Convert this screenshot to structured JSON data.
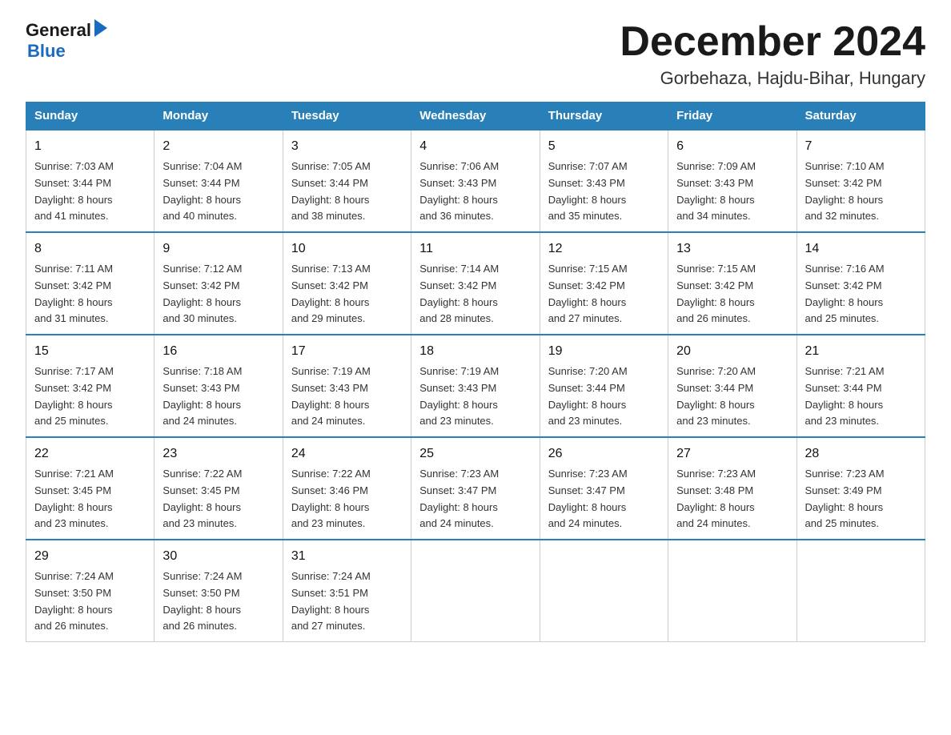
{
  "logo": {
    "general": "General",
    "blue": "Blue"
  },
  "header": {
    "month": "December 2024",
    "location": "Gorbehaza, Hajdu-Bihar, Hungary"
  },
  "days_of_week": [
    "Sunday",
    "Monday",
    "Tuesday",
    "Wednesday",
    "Thursday",
    "Friday",
    "Saturday"
  ],
  "weeks": [
    [
      {
        "day": "1",
        "sunrise": "7:03 AM",
        "sunset": "3:44 PM",
        "daylight": "8 hours and 41 minutes."
      },
      {
        "day": "2",
        "sunrise": "7:04 AM",
        "sunset": "3:44 PM",
        "daylight": "8 hours and 40 minutes."
      },
      {
        "day": "3",
        "sunrise": "7:05 AM",
        "sunset": "3:44 PM",
        "daylight": "8 hours and 38 minutes."
      },
      {
        "day": "4",
        "sunrise": "7:06 AM",
        "sunset": "3:43 PM",
        "daylight": "8 hours and 36 minutes."
      },
      {
        "day": "5",
        "sunrise": "7:07 AM",
        "sunset": "3:43 PM",
        "daylight": "8 hours and 35 minutes."
      },
      {
        "day": "6",
        "sunrise": "7:09 AM",
        "sunset": "3:43 PM",
        "daylight": "8 hours and 34 minutes."
      },
      {
        "day": "7",
        "sunrise": "7:10 AM",
        "sunset": "3:42 PM",
        "daylight": "8 hours and 32 minutes."
      }
    ],
    [
      {
        "day": "8",
        "sunrise": "7:11 AM",
        "sunset": "3:42 PM",
        "daylight": "8 hours and 31 minutes."
      },
      {
        "day": "9",
        "sunrise": "7:12 AM",
        "sunset": "3:42 PM",
        "daylight": "8 hours and 30 minutes."
      },
      {
        "day": "10",
        "sunrise": "7:13 AM",
        "sunset": "3:42 PM",
        "daylight": "8 hours and 29 minutes."
      },
      {
        "day": "11",
        "sunrise": "7:14 AM",
        "sunset": "3:42 PM",
        "daylight": "8 hours and 28 minutes."
      },
      {
        "day": "12",
        "sunrise": "7:15 AM",
        "sunset": "3:42 PM",
        "daylight": "8 hours and 27 minutes."
      },
      {
        "day": "13",
        "sunrise": "7:15 AM",
        "sunset": "3:42 PM",
        "daylight": "8 hours and 26 minutes."
      },
      {
        "day": "14",
        "sunrise": "7:16 AM",
        "sunset": "3:42 PM",
        "daylight": "8 hours and 25 minutes."
      }
    ],
    [
      {
        "day": "15",
        "sunrise": "7:17 AM",
        "sunset": "3:42 PM",
        "daylight": "8 hours and 25 minutes."
      },
      {
        "day": "16",
        "sunrise": "7:18 AM",
        "sunset": "3:43 PM",
        "daylight": "8 hours and 24 minutes."
      },
      {
        "day": "17",
        "sunrise": "7:19 AM",
        "sunset": "3:43 PM",
        "daylight": "8 hours and 24 minutes."
      },
      {
        "day": "18",
        "sunrise": "7:19 AM",
        "sunset": "3:43 PM",
        "daylight": "8 hours and 23 minutes."
      },
      {
        "day": "19",
        "sunrise": "7:20 AM",
        "sunset": "3:44 PM",
        "daylight": "8 hours and 23 minutes."
      },
      {
        "day": "20",
        "sunrise": "7:20 AM",
        "sunset": "3:44 PM",
        "daylight": "8 hours and 23 minutes."
      },
      {
        "day": "21",
        "sunrise": "7:21 AM",
        "sunset": "3:44 PM",
        "daylight": "8 hours and 23 minutes."
      }
    ],
    [
      {
        "day": "22",
        "sunrise": "7:21 AM",
        "sunset": "3:45 PM",
        "daylight": "8 hours and 23 minutes."
      },
      {
        "day": "23",
        "sunrise": "7:22 AM",
        "sunset": "3:45 PM",
        "daylight": "8 hours and 23 minutes."
      },
      {
        "day": "24",
        "sunrise": "7:22 AM",
        "sunset": "3:46 PM",
        "daylight": "8 hours and 23 minutes."
      },
      {
        "day": "25",
        "sunrise": "7:23 AM",
        "sunset": "3:47 PM",
        "daylight": "8 hours and 24 minutes."
      },
      {
        "day": "26",
        "sunrise": "7:23 AM",
        "sunset": "3:47 PM",
        "daylight": "8 hours and 24 minutes."
      },
      {
        "day": "27",
        "sunrise": "7:23 AM",
        "sunset": "3:48 PM",
        "daylight": "8 hours and 24 minutes."
      },
      {
        "day": "28",
        "sunrise": "7:23 AM",
        "sunset": "3:49 PM",
        "daylight": "8 hours and 25 minutes."
      }
    ],
    [
      {
        "day": "29",
        "sunrise": "7:24 AM",
        "sunset": "3:50 PM",
        "daylight": "8 hours and 26 minutes."
      },
      {
        "day": "30",
        "sunrise": "7:24 AM",
        "sunset": "3:50 PM",
        "daylight": "8 hours and 26 minutes."
      },
      {
        "day": "31",
        "sunrise": "7:24 AM",
        "sunset": "3:51 PM",
        "daylight": "8 hours and 27 minutes."
      },
      null,
      null,
      null,
      null
    ]
  ],
  "labels": {
    "sunrise": "Sunrise:",
    "sunset": "Sunset:",
    "daylight": "Daylight:"
  }
}
